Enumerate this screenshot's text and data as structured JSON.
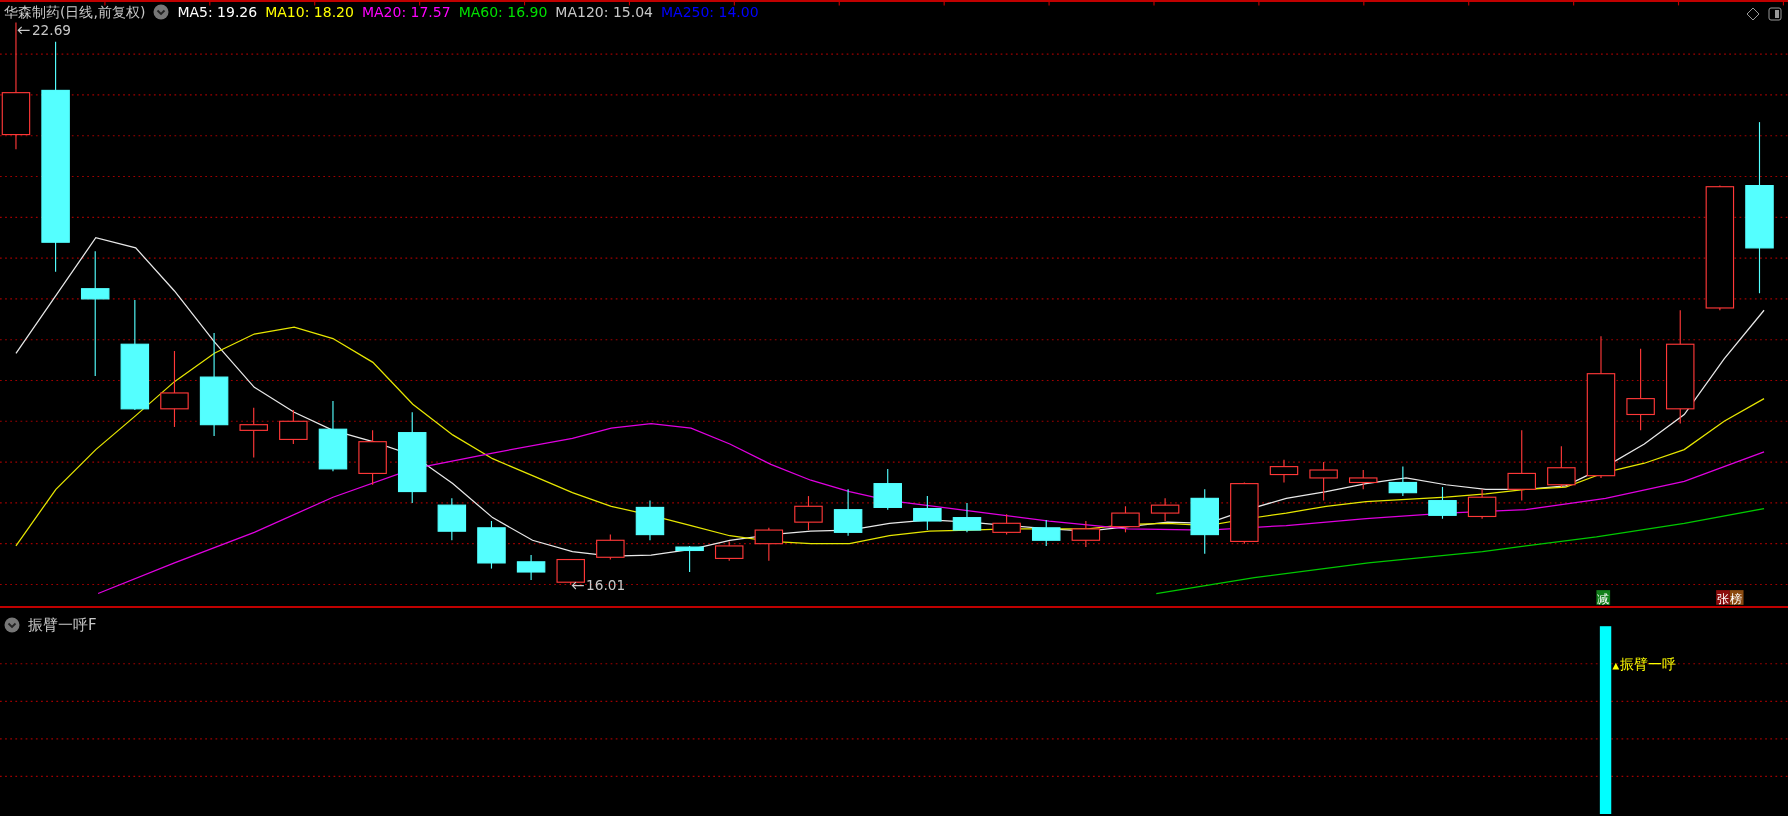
{
  "header": {
    "title": "华森制药(日线,前复权)",
    "indicators": [
      {
        "label": "MA5: 19.26",
        "color": "#ffffff"
      },
      {
        "label": "MA10: 18.20",
        "color": "#ffff00"
      },
      {
        "label": "MA20: 17.57",
        "color": "#ff00ff"
      },
      {
        "label": "MA60: 16.90",
        "color": "#00e000"
      },
      {
        "label": "MA120: 15.04",
        "color": "#c8c8c8"
      },
      {
        "label": "MA250: 14.00",
        "color": "#0000ff"
      }
    ]
  },
  "price_labels": [
    {
      "text": "22.69",
      "kind": "high"
    },
    {
      "text": "16.01",
      "kind": "low"
    }
  ],
  "signal_tags": [
    {
      "text": "减",
      "color": "#11801a"
    },
    {
      "text": "张",
      "color": "#8c0c0c"
    },
    {
      "text": "榜",
      "color": "#8a4a10"
    }
  ],
  "indicator_panel": {
    "title": "振臂一呼F",
    "signal_label": "振臂一呼"
  }
}
